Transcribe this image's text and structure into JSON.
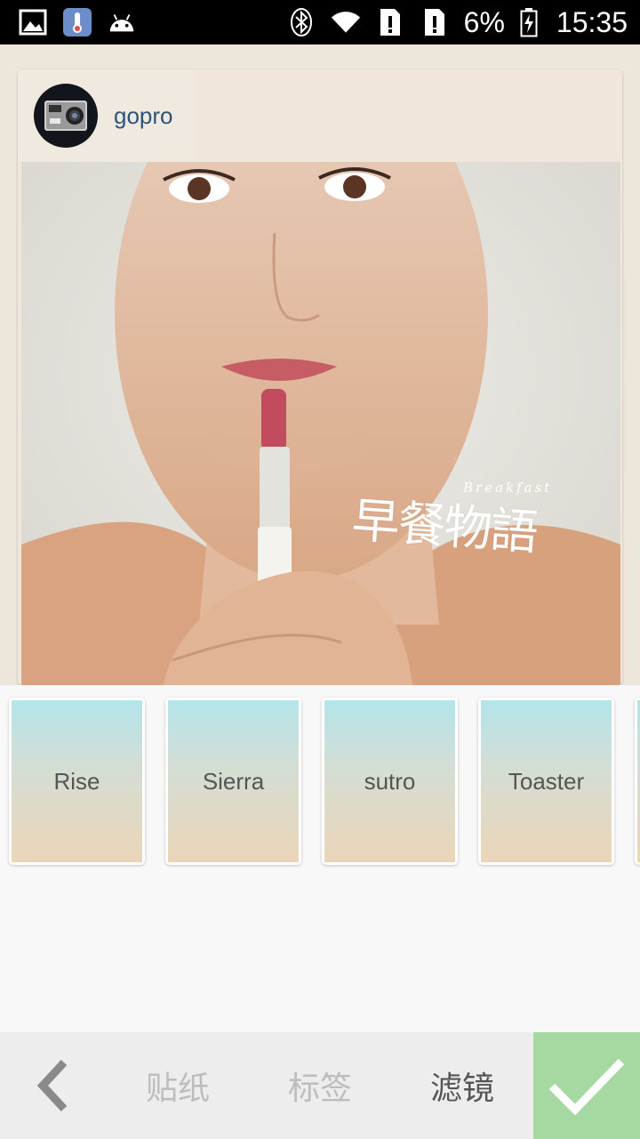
{
  "status_bar": {
    "battery": "6%",
    "time": "15:35"
  },
  "post": {
    "username": "gopro",
    "overlay_title": "早餐物語",
    "overlay_subtitle": "Breakfast"
  },
  "filters": [
    {
      "label": "Rise"
    },
    {
      "label": "Sierra"
    },
    {
      "label": "sutro"
    },
    {
      "label": "Toaster"
    }
  ],
  "bottom_bar": {
    "tabs": [
      {
        "label": "贴纸",
        "active": false
      },
      {
        "label": "标签",
        "active": false
      },
      {
        "label": "滤镜",
        "active": true
      }
    ],
    "confirm_color": "#a6d8a2"
  },
  "icons": [
    "image-icon",
    "thermometer-icon",
    "android-icon",
    "bluetooth-icon",
    "wifi-icon",
    "sim-alert-icon",
    "battery-charging-icon",
    "back-chevron-icon",
    "check-icon"
  ]
}
